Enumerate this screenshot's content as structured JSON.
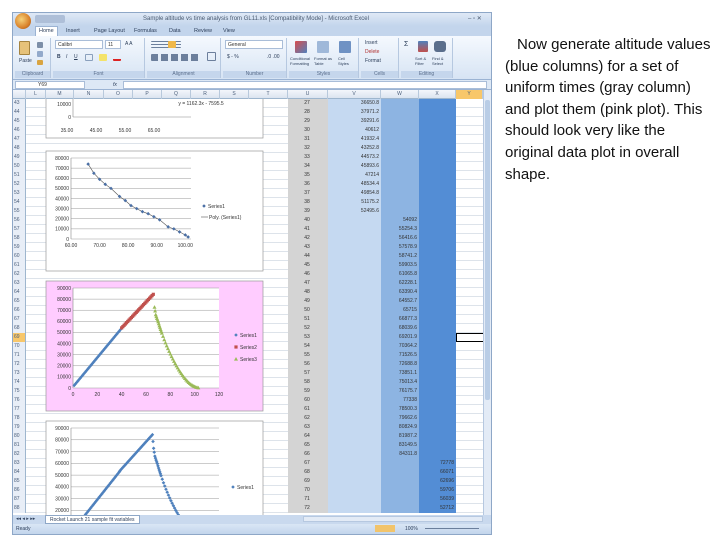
{
  "window": {
    "title": "Sample altitude vs time analysis from GL11.xls [Compatibility Mode] - Microsoft Excel"
  },
  "ribbon": {
    "tabs": [
      "Home",
      "Insert",
      "Page Layout",
      "Formulas",
      "Data",
      "Review",
      "View"
    ],
    "clipboard": {
      "paste": "Paste",
      "label": "Clipboard"
    },
    "font": {
      "name": "Calibri",
      "size": "11",
      "label": "Font",
      "bold": "B",
      "italic": "I",
      "underline": "U"
    },
    "alignment": {
      "label": "Alignment"
    },
    "number": {
      "format": "General",
      "currency": "$ - %",
      "label": "Number"
    },
    "styles": {
      "conditional": "Conditional Formatting",
      "format_table": "Format as Table",
      "cell_styles": "Cell Styles",
      "label": "Styles"
    },
    "cells": {
      "insert": "Insert",
      "delete": "Delete",
      "format": "Format",
      "label": "Cells"
    },
    "editing": {
      "sort": "Sort & Filter",
      "find": "Find & Select",
      "label": "Editing"
    }
  },
  "formula_bar": {
    "name_box": "Y69",
    "fx": "fx",
    "value": ""
  },
  "columns": [
    "L",
    "M",
    "N",
    "O",
    "P",
    "Q",
    "R",
    "S",
    "T",
    "U",
    "V",
    "W",
    "X",
    "Y"
  ],
  "rows": {
    "first": 43,
    "last": 88,
    "selected": 69
  },
  "data_cells": {
    "U": [
      27,
      28,
      29,
      30,
      31,
      32,
      33,
      34,
      35,
      36,
      37,
      38,
      39,
      40,
      41,
      42,
      43,
      44,
      45,
      46,
      47,
      48,
      49,
      50,
      51,
      52,
      53,
      54,
      55,
      56,
      57,
      58,
      59,
      60,
      61,
      62,
      63,
      64,
      65,
      66,
      67,
      68,
      69,
      70,
      71,
      72
    ],
    "V": [
      "36650.8",
      "37971.2",
      "39291.6",
      "40612",
      "41932.4",
      "43252.8",
      "44573.2",
      "45893.6",
      "47214",
      "48534.4",
      "49854.8",
      "51175.2",
      "52495.6"
    ],
    "W": [
      "54092",
      "55254.3",
      "56416.6",
      "57578.9",
      "58741.2",
      "59903.5",
      "61065.8",
      "62228.1",
      "63390.4",
      "64552.7",
      "65715",
      "66877.3",
      "68039.6",
      "69201.9",
      "70364.2",
      "71526.5",
      "72688.8",
      "73851.1",
      "75013.4",
      "76175.7",
      "77338",
      "78500.3",
      "79662.6",
      "80824.9",
      "81987.2",
      "83149.5",
      "84311.8"
    ],
    "X": [
      "72778",
      "66071",
      "62696",
      "59706",
      "56039",
      "52712"
    ]
  },
  "colors": {
    "gray_col": "#d4d4d4",
    "light_blue": "#c5d9f1",
    "mid_blue": "#8db4e2",
    "dark_blue": "#538dd5",
    "pink": "#ffccff",
    "series1": "#4f81bd",
    "series2": "#c0504d",
    "series3": "#9bbb59"
  },
  "sheet_tab": "Rocket Launch 21 sample fit variables",
  "status": {
    "ready": "Ready",
    "zoom": "100%"
  },
  "note": "Now generate altitude values (blue columns) for a set of uniform times (gray column) and plot them (pink plot). This should look very like the original data plot in overall shape.",
  "chart_data": [
    {
      "type": "scatter",
      "title": "",
      "equation": "y = 1162.3x - 7595.5",
      "ylim": [
        0,
        20000
      ],
      "yticks": [
        "10000",
        "0"
      ],
      "xticks": [
        "35.00",
        "45.00",
        "55.00",
        "65.00"
      ]
    },
    {
      "type": "scatter",
      "title": "",
      "xlim": [
        60,
        102
      ],
      "ylim": [
        0,
        80000
      ],
      "yticks": [
        "80000",
        "70000",
        "60000",
        "50000",
        "40000",
        "30000",
        "20000",
        "10000",
        "0"
      ],
      "xticks": [
        "60.00",
        "70.00",
        "80.00",
        "90.00",
        "100.00"
      ],
      "legend": [
        "Series1",
        "Poly. (Series1)"
      ],
      "legend_position": "right",
      "series": [
        {
          "name": "Series1",
          "points": [
            [
              66,
              74000
            ],
            [
              68,
              65000
            ],
            [
              70,
              59000
            ],
            [
              72,
              54000
            ],
            [
              74,
              50000
            ],
            [
              77,
              42000
            ],
            [
              79,
              38000
            ],
            [
              81,
              33000
            ],
            [
              83,
              30000
            ],
            [
              85,
              27000
            ],
            [
              87,
              25000
            ],
            [
              89,
              22000
            ],
            [
              91,
              19000
            ],
            [
              94,
              12000
            ],
            [
              96,
              10000
            ],
            [
              98,
              7000
            ],
            [
              100,
              4000
            ],
            [
              101,
              2000
            ]
          ]
        }
      ]
    },
    {
      "type": "scatter",
      "title": "",
      "xlim": [
        0,
        120
      ],
      "ylim": [
        0,
        90000
      ],
      "yticks": [
        "90000",
        "80000",
        "70000",
        "60000",
        "50000",
        "40000",
        "30000",
        "20000",
        "10000",
        "0"
      ],
      "xticks": [
        "0",
        "20",
        "40",
        "60",
        "80",
        "100",
        "120"
      ],
      "legend": [
        "Series1",
        "Series2",
        "Series3"
      ],
      "legend_position": "right",
      "series": [
        {
          "name": "Series1",
          "points": [
            [
              1,
              2320.4
            ],
            [
              3,
              4961.2
            ],
            [
              5,
              7602
            ],
            [
              7,
              10242.8
            ],
            [
              9,
              12883.6
            ],
            [
              11,
              15524.4
            ],
            [
              13,
              18165.2
            ],
            [
              15,
              20806
            ],
            [
              17,
              23446.8
            ],
            [
              19,
              26087.6
            ],
            [
              21,
              28728.4
            ],
            [
              23,
              31369.2
            ],
            [
              25,
              34010
            ],
            [
              27,
              36650.8
            ],
            [
              29,
              39291.6
            ],
            [
              31,
              41932.4
            ],
            [
              33,
              44573.2
            ],
            [
              35,
              47214
            ],
            [
              37,
              49854.8
            ],
            [
              39,
              52495.6
            ]
          ]
        },
        {
          "name": "Series2",
          "points": [
            [
              40,
              54092
            ],
            [
              42,
              56416.6
            ],
            [
              44,
              58741.2
            ],
            [
              46,
              61065.8
            ],
            [
              48,
              63390.4
            ],
            [
              50,
              65715
            ],
            [
              52,
              68039.6
            ],
            [
              54,
              70364.2
            ],
            [
              56,
              72688.8
            ],
            [
              58,
              75013.4
            ],
            [
              60,
              77338
            ],
            [
              62,
              79662.6
            ],
            [
              64,
              81987.2
            ],
            [
              66,
              84311.8
            ]
          ]
        },
        {
          "name": "Series3",
          "points": [
            [
              67,
              72778
            ],
            [
              68,
              66071
            ],
            [
              69,
              62696
            ],
            [
              70,
              59706
            ],
            [
              71,
              56039
            ],
            [
              72,
              52712
            ],
            [
              73,
              49500
            ],
            [
              75,
              43500
            ],
            [
              77,
              38000
            ],
            [
              79,
              33000
            ],
            [
              81,
              28300
            ],
            [
              83,
              24000
            ],
            [
              85,
              20000
            ],
            [
              87,
              16300
            ],
            [
              89,
              13000
            ],
            [
              91,
              10000
            ],
            [
              93,
              7300
            ],
            [
              95,
              5000
            ],
            [
              97,
              3200
            ],
            [
              99,
              1800
            ],
            [
              101,
              800
            ],
            [
              103,
              200
            ]
          ]
        }
      ]
    },
    {
      "type": "scatter",
      "title": "",
      "xlim": [
        0,
        120
      ],
      "ylim": [
        0,
        90000
      ],
      "yticks": [
        "90000",
        "80000",
        "70000",
        "60000",
        "50000",
        "40000",
        "30000",
        "20000"
      ],
      "legend": [
        "Series1"
      ],
      "legend_position": "right",
      "series": [
        {
          "name": "Series1",
          "points": "same as chart 3 combined"
        }
      ]
    }
  ]
}
